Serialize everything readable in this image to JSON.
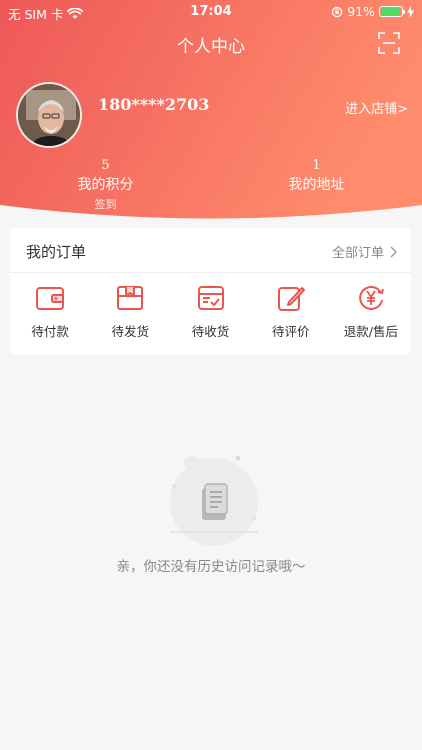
{
  "status_bar": {
    "carrier": "无 SIM 卡",
    "time": "17:04",
    "battery": "91%"
  },
  "header": {
    "title": "个人中心"
  },
  "profile": {
    "phone": "180****2703",
    "enter_shop": "进入店铺>"
  },
  "stats": {
    "points": {
      "value": "5",
      "label": "我的积分",
      "sub": "签到"
    },
    "address": {
      "value": "1",
      "label": "我的地址"
    }
  },
  "orders": {
    "title": "我的订单",
    "all_label": "全部订单",
    "items": [
      {
        "label": "待付款",
        "icon": "wallet-icon"
      },
      {
        "label": "待发货",
        "icon": "package-icon"
      },
      {
        "label": "待收货",
        "icon": "delivery-box-icon"
      },
      {
        "label": "待评价",
        "icon": "edit-review-icon"
      },
      {
        "label": "退款/售后",
        "icon": "refund-yen-icon"
      }
    ]
  },
  "empty": {
    "message": "亲，你还没有历史访问记录哦～"
  },
  "colors": {
    "accent": "#ef4a4a",
    "gradient_start": "#ee5a5a",
    "gradient_end": "#ff8a6a"
  }
}
